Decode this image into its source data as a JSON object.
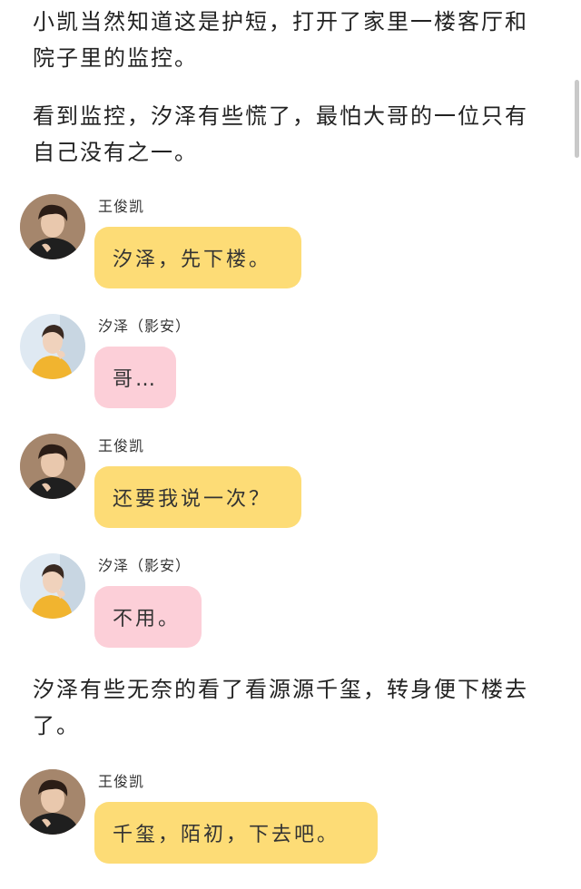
{
  "paragraphs": [
    "小凯当然知道这是护短，打开了家里一楼客厅和院子里的监控。",
    "看到监控，汐泽有些慌了，最怕大哥的一位只有自己没有之一。",
    "汐泽有些无奈的看了看源源千玺，转身便下楼去了。"
  ],
  "messages": [
    {
      "speaker": "王俊凯",
      "text": "汐泽，先下楼。"
    },
    {
      "speaker": "汐泽（影安）",
      "text": "哥…"
    },
    {
      "speaker": "王俊凯",
      "text": "还要我说一次？"
    },
    {
      "speaker": "汐泽（影安）",
      "text": "不用。"
    },
    {
      "speaker": "王俊凯",
      "text": "千玺，陌初，下去吧。"
    }
  ],
  "colors": {
    "bubble_yellow": "#fddc76",
    "bubble_pink": "#fccfd8",
    "text": "#222222"
  },
  "icons": {
    "avatar_wang": "avatar-boy-dark-jacket",
    "avatar_xize": "avatar-boy-yellow-shirt"
  }
}
